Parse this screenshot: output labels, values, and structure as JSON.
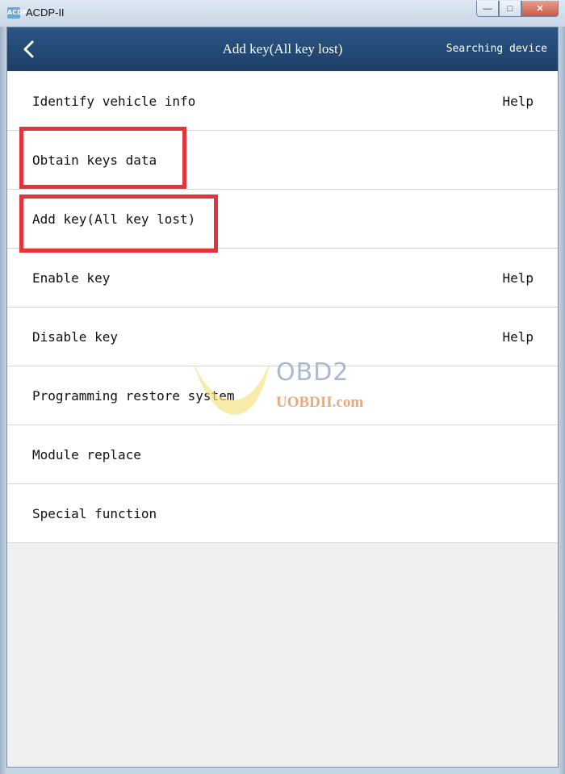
{
  "window": {
    "title": "ACDP-II",
    "icon_text": "ACDP",
    "minimize_glyph": "—",
    "maximize_glyph": "□",
    "close_glyph": "✕"
  },
  "header": {
    "title": "Add key(All key lost)",
    "status": "Searching device"
  },
  "menu": {
    "items": [
      {
        "label": "Identify vehicle info",
        "help": "Help"
      },
      {
        "label": "Obtain keys data",
        "help": ""
      },
      {
        "label": "Add key(All key lost)",
        "help": ""
      },
      {
        "label": "Enable key",
        "help": "Help"
      },
      {
        "label": "Disable key",
        "help": "Help"
      },
      {
        "label": "Programming restore system",
        "help": ""
      },
      {
        "label": "Module replace",
        "help": ""
      },
      {
        "label": "Special function",
        "help": ""
      }
    ]
  },
  "watermark": {
    "brand": "OBD2",
    "site": "UOBDII.com"
  },
  "colors": {
    "header": "#1c3e66",
    "highlight_box": "#e3343b"
  }
}
